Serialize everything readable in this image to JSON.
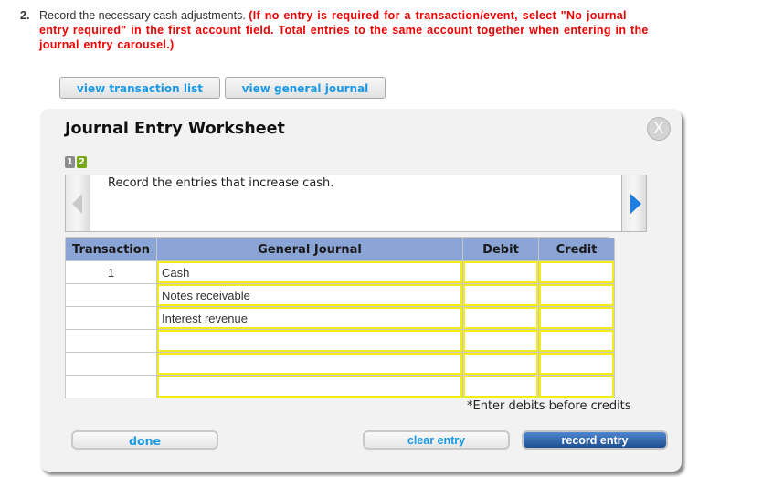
{
  "question": {
    "number": "2.",
    "text": "Record the necessary cash adjustments. ",
    "instruction": "(If no entry is required for a transaction/event, select \"No journal entry required\" in the first account field. Total entries to the same account together when entering in the journal entry carousel.)"
  },
  "top_buttons": {
    "view_transaction_list": "view transaction list",
    "view_general_journal": "view general journal"
  },
  "worksheet": {
    "title": "Journal Entry Worksheet",
    "close_icon": "X",
    "pages": [
      {
        "label": "1",
        "state": "inactive",
        "color": "#8c8c8c"
      },
      {
        "label": "2",
        "state": "active",
        "color": "#76a815"
      }
    ],
    "carousel_text": "Record the entries that increase cash.",
    "columns": [
      "Transaction",
      "General Journal",
      "Debit",
      "Credit"
    ],
    "rows": [
      {
        "transaction": "1",
        "account": "Cash",
        "debit": "",
        "credit": ""
      },
      {
        "transaction": "",
        "account": "Notes receivable",
        "debit": "",
        "credit": ""
      },
      {
        "transaction": "",
        "account": "Interest revenue",
        "debit": "",
        "credit": ""
      },
      {
        "transaction": "",
        "account": "",
        "debit": "",
        "credit": ""
      },
      {
        "transaction": "",
        "account": "",
        "debit": "",
        "credit": ""
      },
      {
        "transaction": "",
        "account": "",
        "debit": "",
        "credit": ""
      }
    ],
    "note": "*Enter debits before credits",
    "buttons": {
      "done": "done",
      "clear_entry": "clear entry",
      "record_entry": "record entry"
    }
  },
  "colors": {
    "instruction_red": "#ee0000",
    "header_blue": "#8aa4d5",
    "input_border_yellow": "#f2ec1c",
    "link_blue": "#1a9ae6",
    "primary_button": "#1f4f91"
  }
}
